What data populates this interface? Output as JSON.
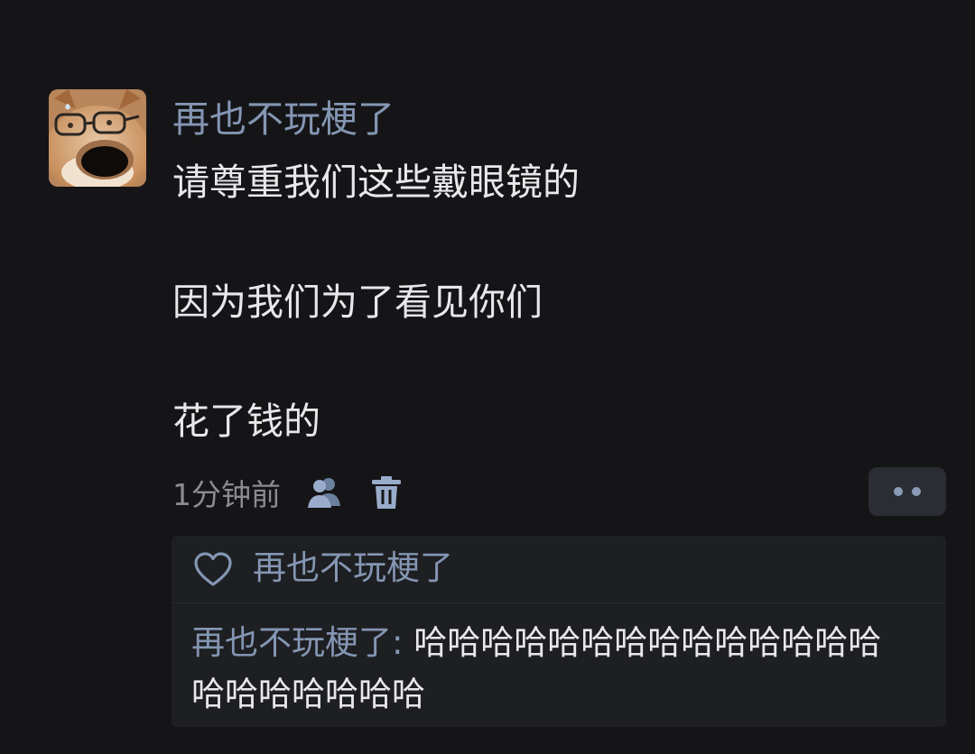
{
  "post": {
    "avatar_icon": "shiba-dog-with-glasses-avatar",
    "username": "再也不玩梗了",
    "lines": [
      "请尊重我们这些戴眼镜的",
      "因为我们为了看见你们",
      "花了钱的"
    ],
    "timestamp": "1分钟前",
    "icons": {
      "visibility": "users-icon",
      "delete": "trash-icon",
      "more": "more-dots-icon"
    }
  },
  "reply_panel": {
    "like_icon": "heart-outline-icon",
    "liker": "再也不玩梗了",
    "reply_author": "再也不玩梗了",
    "reply_separator": ":",
    "reply_body": " 哈哈哈哈哈哈哈哈哈哈哈哈哈哈哈哈哈哈哈哈哈"
  },
  "colors": {
    "background": "#151517",
    "name_link": "#8496b3",
    "text": "#e8e8ea",
    "muted": "#8a8c92",
    "panel": "#1e1f22",
    "button": "#2a2d33"
  }
}
